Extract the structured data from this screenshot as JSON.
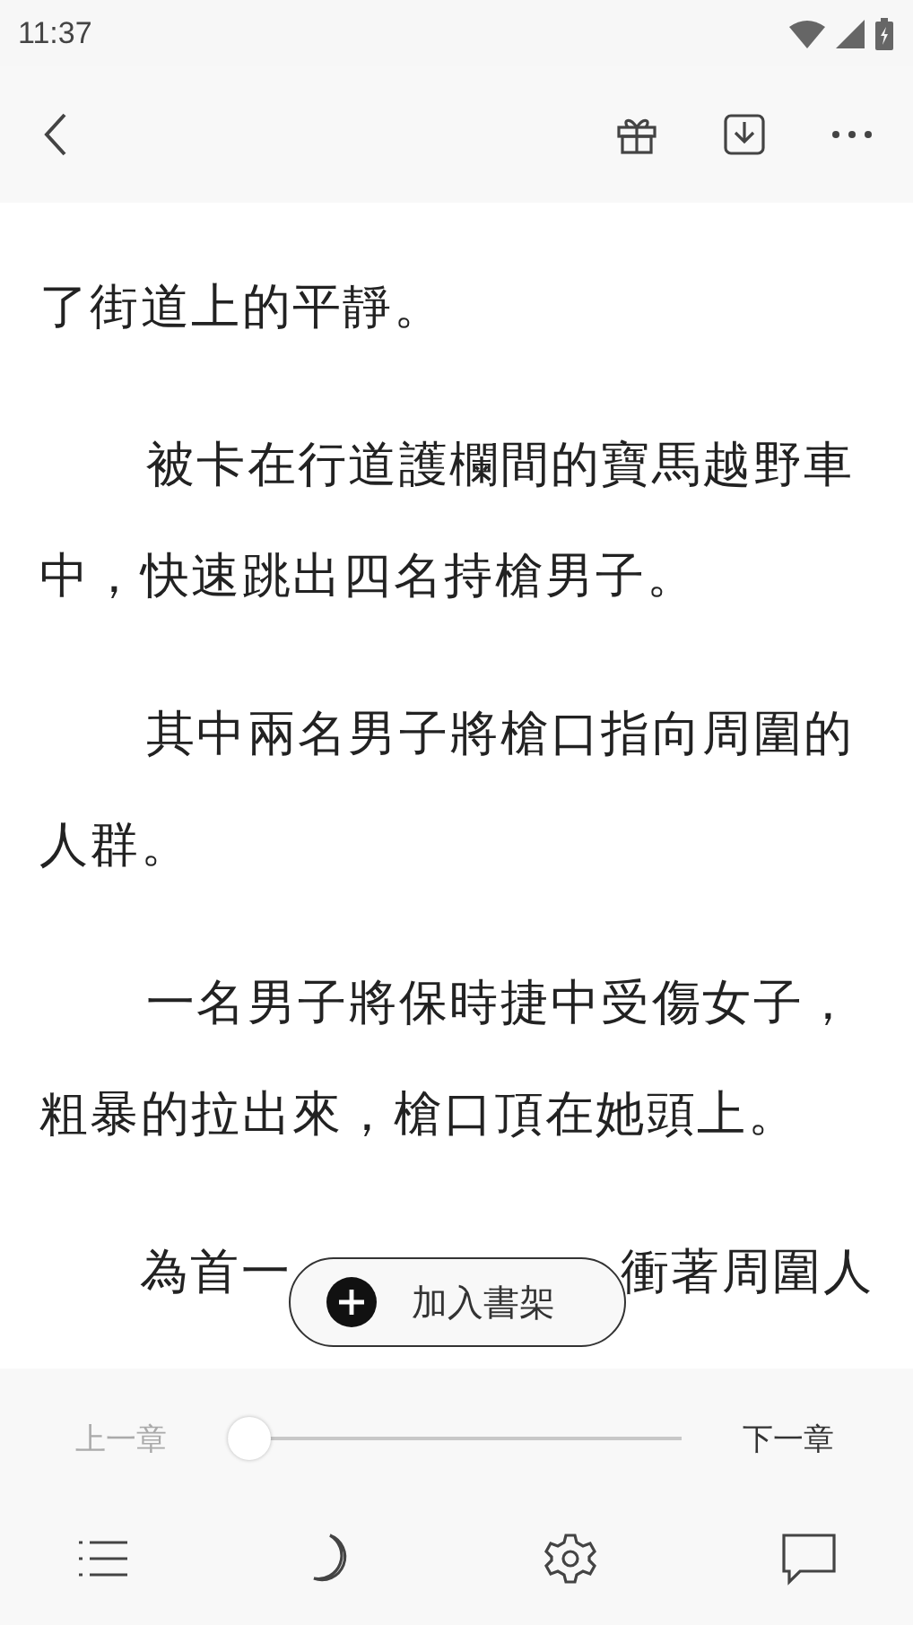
{
  "status_bar": {
    "time": "11:37"
  },
  "paragraphs": [
    {
      "kind": "continuation",
      "text": "了街道上的平靜。"
    },
    {
      "kind": "paragraph",
      "text": "被卡在行道護欄間的寶馬越野車中，快速跳出四名持槍男子。"
    },
    {
      "kind": "paragraph",
      "text": "其中兩名男子將槍口指向周圍的人群。"
    },
    {
      "kind": "paragraph",
      "text": "一名男子將保時捷中受傷女子，粗暴的拉出來，槍口頂在她頭上。"
    },
    {
      "kind": "covered",
      "parts": [
        "為首一",
        "衝著周圍人"
      ]
    }
  ],
  "shelf_button": {
    "label": "加入書架"
  },
  "chapter_nav": {
    "previous": {
      "label": "上一章",
      "disabled": true
    },
    "next": {
      "label": "下一章",
      "disabled": false
    },
    "progress": {
      "level": 0
    }
  }
}
